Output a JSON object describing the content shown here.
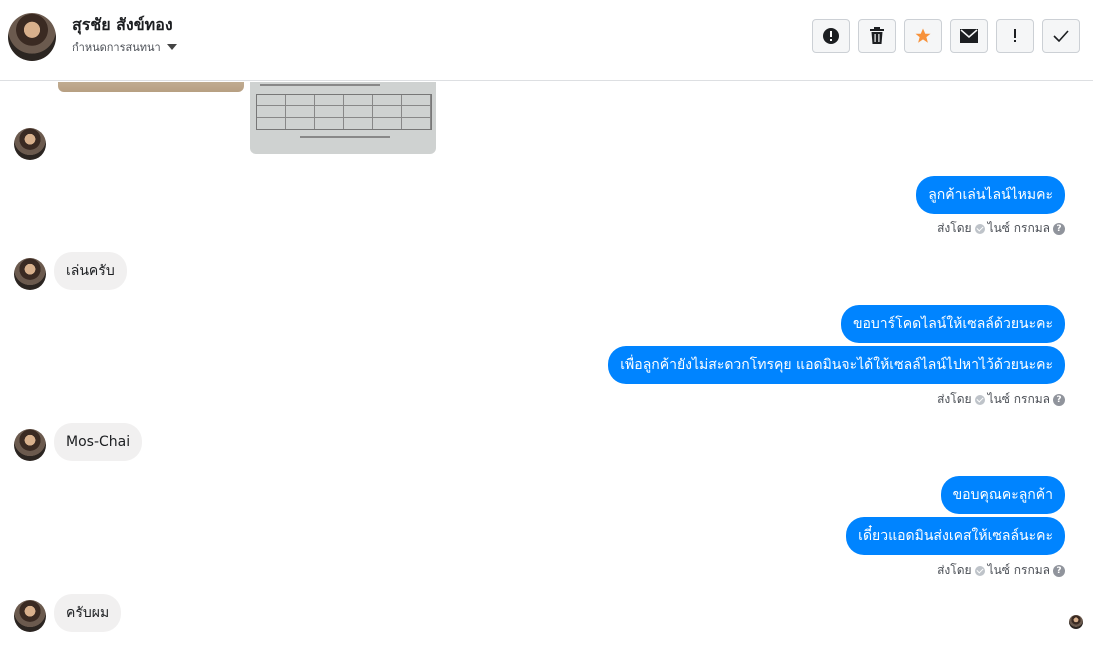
{
  "header": {
    "name": "สุรชัย สังข์ทอง",
    "assign_label": "กำหนดการสนทนา",
    "tools": [
      {
        "icon": "alert-icon",
        "label": "!"
      },
      {
        "icon": "trash-icon"
      },
      {
        "icon": "star-icon",
        "color": "#f7923b"
      },
      {
        "icon": "mail-icon"
      },
      {
        "icon": "exclamation-icon",
        "label": "!"
      },
      {
        "icon": "check-icon"
      }
    ]
  },
  "messages": {
    "out1": "ลูกค้าเล่นไลน์ไหมคะ",
    "meta1": {
      "sent_by": "ส่งโดย",
      "who": "ไนซ์ กรกมล",
      "help": "?"
    },
    "in1": "เล่นครับ",
    "out2a": "ขอบาร์โคดไลน์ให้เซลล์ด้วยนะคะ",
    "out2b": "เพื่อลูกค้ายังไม่สะดวกโทรคุย แอดมินจะได้ให้เซลล์ไลน์ไปหาไว้ด้วยนะคะ",
    "meta2": {
      "sent_by": "ส่งโดย",
      "who": "ไนซ์ กรกมล",
      "help": "?"
    },
    "in2": "Mos-Chai",
    "out3a": "ขอบคุณคะลูกค้า",
    "out3b": "เดี๋ยวแอดมินส่งเคสให้เซลล์นะคะ",
    "meta3": {
      "sent_by": "ส่งโดย",
      "who": "ไนซ์ กรกมล",
      "help": "?"
    },
    "in3": "ครับผม"
  },
  "colors": {
    "outgoing_bubble": "#0084ff",
    "incoming_bubble": "#f1f0f0",
    "star": "#f7923b"
  }
}
